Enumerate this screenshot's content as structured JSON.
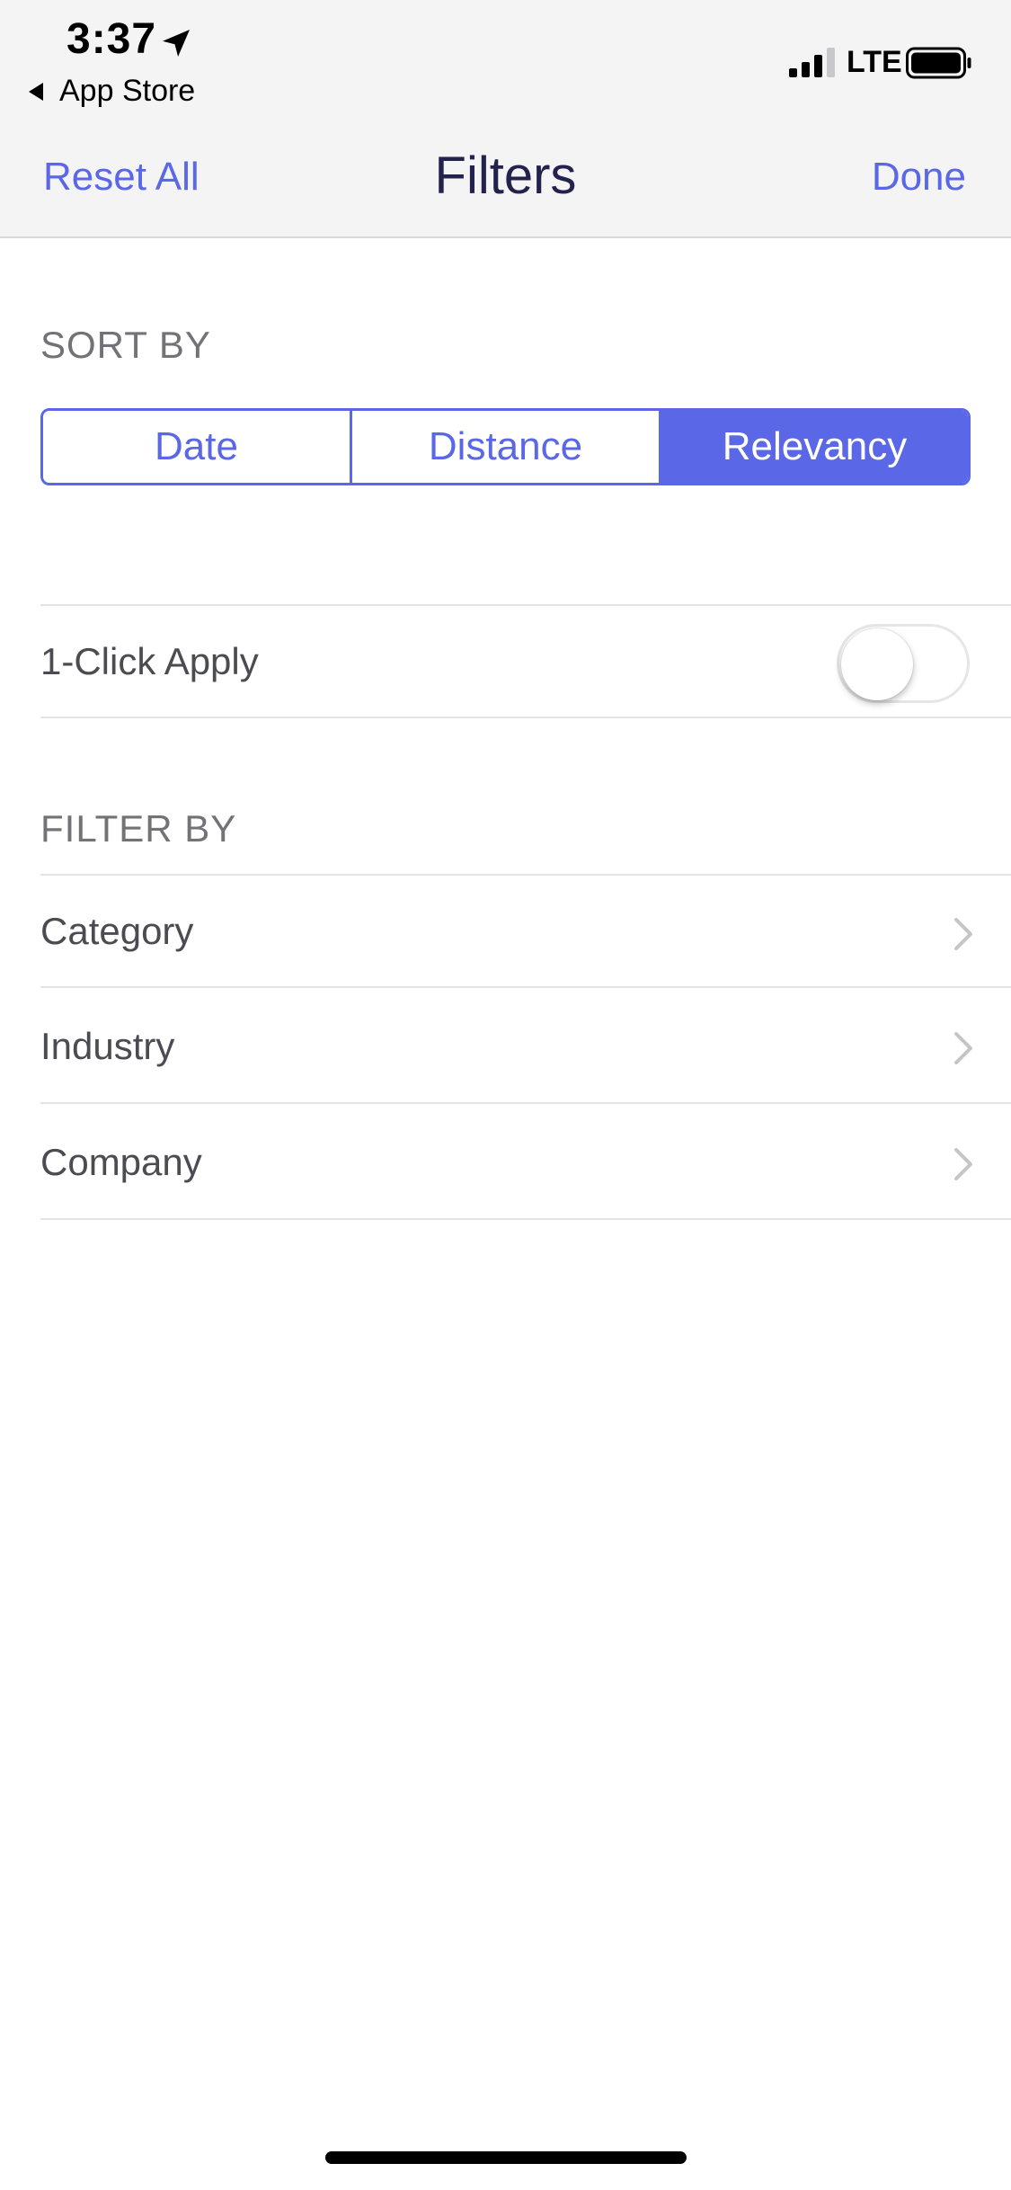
{
  "status_bar": {
    "time": "3:37",
    "back_app": "App Store",
    "network": "LTE",
    "icons": [
      "location-arrow-icon",
      "signal-icon",
      "battery-icon"
    ]
  },
  "nav": {
    "left_label": "Reset All",
    "title": "Filters",
    "right_label": "Done"
  },
  "sort": {
    "header": "SORT BY",
    "options": [
      "Date",
      "Distance",
      "Relevancy"
    ],
    "selected": "Relevancy"
  },
  "one_click": {
    "label": "1-Click Apply",
    "enabled": false
  },
  "filter": {
    "header": "FILTER BY",
    "items": [
      "Category",
      "Industry",
      "Company"
    ]
  },
  "colors": {
    "accent": "#5a67e6",
    "title": "#22224d",
    "section_header": "#727277",
    "row_text": "#4b4b52",
    "separator": "#e3e3e6"
  }
}
